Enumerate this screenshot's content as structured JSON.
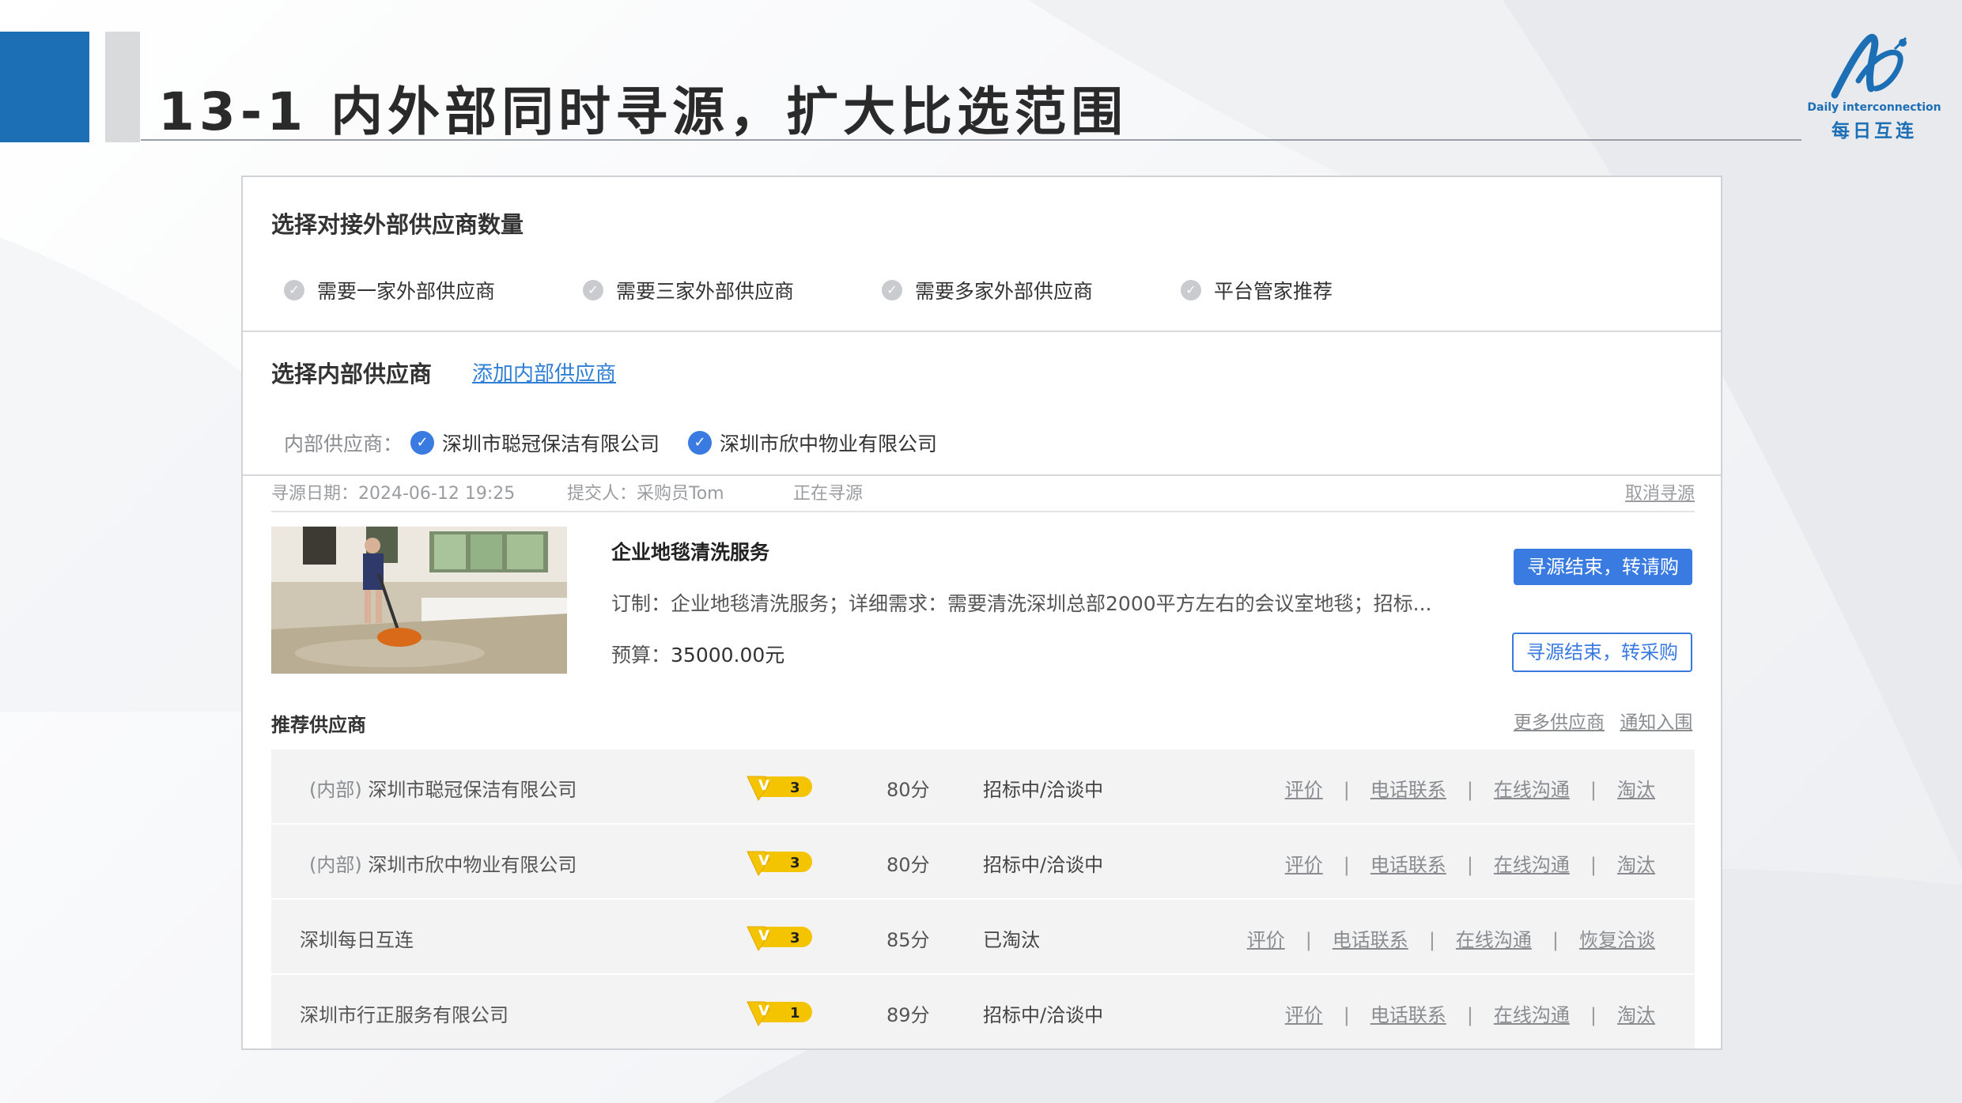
{
  "slide": {
    "title": "13-1 内外部同时寻源，扩大比选范围"
  },
  "logo": {
    "english": "Daily interconnection",
    "chinese": "每日互连"
  },
  "external_section": {
    "heading": "选择对接外部供应商数量",
    "options": [
      {
        "label": "需要一家外部供应商"
      },
      {
        "label": "需要三家外部供应商"
      },
      {
        "label": "需要多家外部供应商"
      },
      {
        "label": "平台管家推荐"
      }
    ]
  },
  "internal_section": {
    "heading": "选择内部供应商",
    "add_link": "添加内部供应商",
    "label": "内部供应商：",
    "selected": [
      {
        "name": "深圳市聪冠保洁有限公司"
      },
      {
        "name": "深圳市欣中物业有限公司"
      }
    ]
  },
  "sourcing": {
    "date": "寻源日期：2024-06-12 19:25",
    "submitter": "提交人：采购员Tom",
    "status": "正在寻源",
    "cancel": "取消寻源"
  },
  "product": {
    "title": "企业地毯清洗服务",
    "description": "订制：企业地毯清洗服务；详细需求：需要清洗深圳总部2000平方左右的会议室地毯；招标...",
    "budget_label": "预算：",
    "budget_value": "35000.00元",
    "btn_request": "寻源结束，转请购",
    "btn_purchase": "寻源结束，转采购"
  },
  "recommended": {
    "heading": "推荐供应商",
    "more_link": "更多供应商",
    "notify_link": "通知入围",
    "suppliers": [
      {
        "tag": "(内部)",
        "name": "深圳市聪冠保洁有限公司",
        "level": "3",
        "score": "80分",
        "status": "招标中/洽谈中",
        "actions": [
          "评价",
          "电话联系",
          "在线沟通",
          "淘汰"
        ]
      },
      {
        "tag": "(内部)",
        "name": "深圳市欣中物业有限公司",
        "level": "3",
        "score": "80分",
        "status": "招标中/洽谈中",
        "actions": [
          "评价",
          "电话联系",
          "在线沟通",
          "淘汰"
        ]
      },
      {
        "tag": "",
        "name": "深圳每日互连",
        "level": "3",
        "score": "85分",
        "status": "已淘汰",
        "actions": [
          "评价",
          "电话联系",
          "在线沟通",
          "恢复洽谈"
        ]
      },
      {
        "tag": "",
        "name": "深圳市行正服务有限公司",
        "level": "1",
        "score": "89分",
        "status": "招标中/洽谈中",
        "actions": [
          "评价",
          "电话联系",
          "在线沟通",
          "淘汰"
        ]
      }
    ]
  },
  "colors": {
    "brand_blue": "#1c6eb5",
    "button_blue": "#3a7be2",
    "badge_yellow": "#f5c400"
  }
}
